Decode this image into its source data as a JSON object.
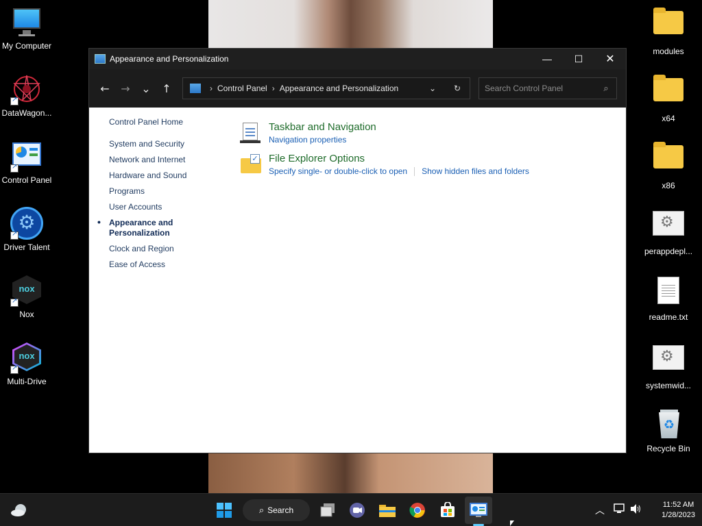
{
  "desktop": {
    "left_icons": [
      {
        "label": "My Computer",
        "icon": "monitor-icon"
      },
      {
        "label": "DataWagon...",
        "icon": "datawagon-icon"
      },
      {
        "label": "Control Panel",
        "icon": "control-panel-icon"
      },
      {
        "label": "Driver Talent",
        "icon": "driver-talent-icon"
      },
      {
        "label": "Nox",
        "icon": "nox-icon"
      },
      {
        "label": "Multi-Drive",
        "icon": "nox-multidrive-icon"
      }
    ],
    "right_icons": [
      {
        "label": "modules",
        "icon": "folder-icon"
      },
      {
        "label": "x64",
        "icon": "folder-icon"
      },
      {
        "label": "x86",
        "icon": "folder-icon"
      },
      {
        "label": "perappdepl...",
        "icon": "settings-file-icon"
      },
      {
        "label": "readme.txt",
        "icon": "text-file-icon"
      },
      {
        "label": "systemwid...",
        "icon": "settings-file-icon"
      },
      {
        "label": "Recycle Bin",
        "icon": "recycle-bin-icon"
      }
    ]
  },
  "window": {
    "title": "Appearance and Personalization",
    "controls": {
      "minimize": "—",
      "maximize": "☐",
      "close": "✕"
    },
    "nav": {
      "back": "←",
      "forward": "→",
      "recent": "⌄",
      "up": "↑"
    },
    "address": {
      "crumbs": [
        "Control Panel",
        "Appearance and Personalization"
      ],
      "separator": "›",
      "dropdown": "⌄",
      "refresh": "↻"
    },
    "search": {
      "placeholder": "Search Control Panel",
      "icon": "⌕"
    },
    "leftnav": {
      "home": "Control Panel Home",
      "items": [
        "System and Security",
        "Network and Internet",
        "Hardware and Sound",
        "Programs",
        "User Accounts",
        "Appearance and Personalization",
        "Clock and Region",
        "Ease of Access"
      ],
      "current_index": 5
    },
    "categories": [
      {
        "title": "Taskbar and Navigation",
        "links": [
          "Navigation properties"
        ]
      },
      {
        "title": "File Explorer Options",
        "links": [
          "Specify single- or double-click to open",
          "Show hidden files and folders"
        ]
      }
    ]
  },
  "taskbar": {
    "search_label": "Search",
    "apps": [
      "start-icon",
      "task-view-icon",
      "teams-chat-icon",
      "file-explorer-icon",
      "chrome-icon",
      "store-icon",
      "control-panel-icon"
    ],
    "time": "11:52 AM",
    "date": "1/28/2023"
  },
  "colors": {
    "category_title": "#1e6b2a",
    "link": "#1a5fb4",
    "leftnav_text": "#1f3a5f",
    "titlebar": "#1f1f1f",
    "taskbar": "#1c1c1c",
    "active_indicator": "#60cdff"
  }
}
